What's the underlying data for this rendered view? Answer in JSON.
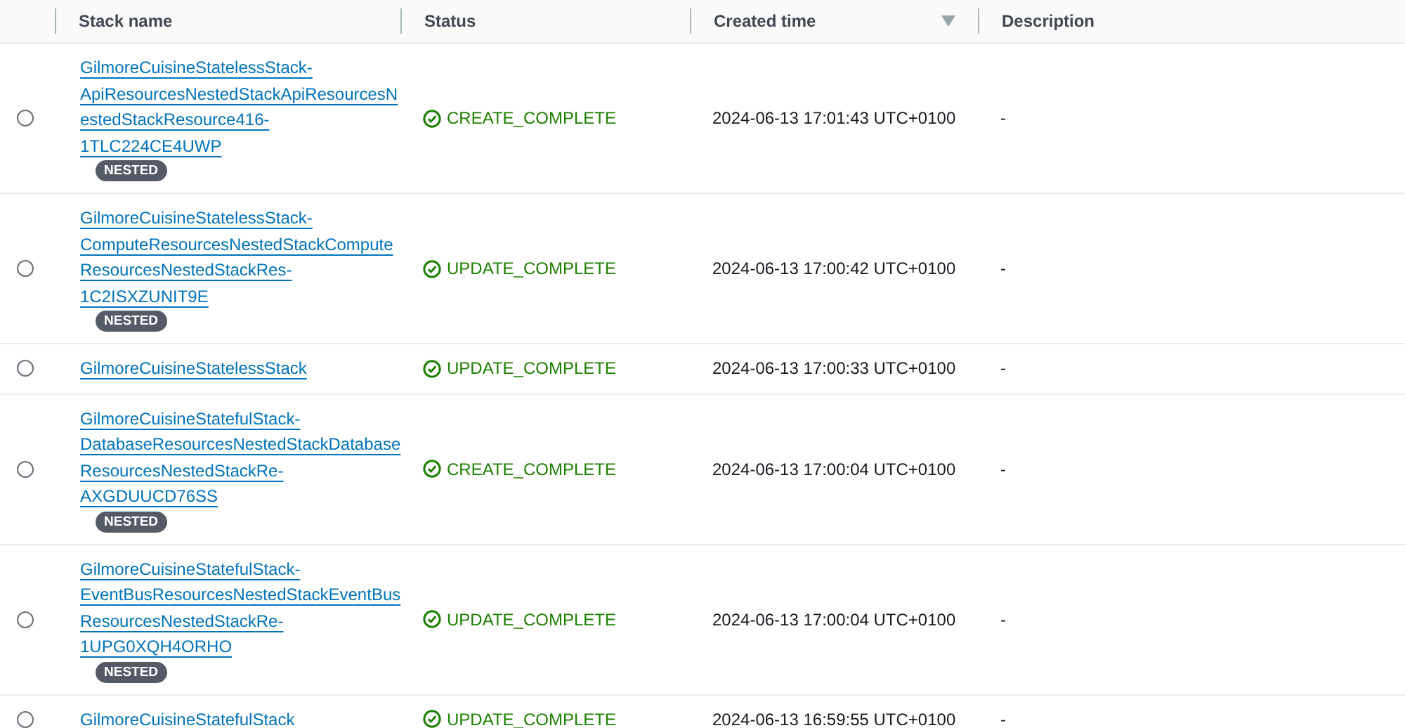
{
  "table": {
    "columns": [
      {
        "label": "Stack name",
        "sort_icon": false
      },
      {
        "label": "Status",
        "sort_icon": false
      },
      {
        "label": "Created time",
        "sort_icon": true
      },
      {
        "label": "Description",
        "sort_icon": false
      }
    ],
    "rows": [
      {
        "selected": false,
        "name_lines": [
          "GilmoreCuisineStatelessStack-",
          "ApiResourcesNestedStackApiResourcesN",
          "estedStackResource416-",
          "1TLC224CE4UWP"
        ],
        "badge": "NESTED",
        "status": "CREATE_COMPLETE",
        "created": "2024-06-13 17:01:43 UTC+0100",
        "description": "-"
      },
      {
        "selected": false,
        "name_lines": [
          "GilmoreCuisineStatelessStack-",
          "ComputeResourcesNestedStackCompute",
          "ResourcesNestedStackRes-",
          "1C2ISXZUNIT9E"
        ],
        "badge": "NESTED",
        "status": "UPDATE_COMPLETE",
        "created": "2024-06-13 17:00:42 UTC+0100",
        "description": "-"
      },
      {
        "selected": false,
        "name_lines": [
          "GilmoreCuisineStatelessStack"
        ],
        "status": "UPDATE_COMPLETE",
        "created": "2024-06-13 17:00:33 UTC+0100",
        "description": "-"
      },
      {
        "selected": false,
        "name_lines": [
          "GilmoreCuisineStatefulStack-",
          "DatabaseResourcesNestedStackDatabase",
          "ResourcesNestedStackRe-",
          "AXGDUUCD76SS"
        ],
        "badge": "NESTED",
        "status": "CREATE_COMPLETE",
        "created": "2024-06-13 17:00:04 UTC+0100",
        "description": "-"
      },
      {
        "selected": false,
        "name_lines": [
          "GilmoreCuisineStatefulStack-",
          "EventBusResourcesNestedStackEventBus",
          "ResourcesNestedStackRe-",
          "1UPG0XQH4ORHO"
        ],
        "badge": "NESTED",
        "status": "UPDATE_COMPLETE",
        "created": "2024-06-13 17:00:04 UTC+0100",
        "description": "-"
      },
      {
        "selected": false,
        "name_lines": [
          "GilmoreCuisineStatefulStack"
        ],
        "status": "UPDATE_COMPLETE",
        "created": "2024-06-13 16:59:55 UTC+0100",
        "description": "-"
      }
    ]
  }
}
